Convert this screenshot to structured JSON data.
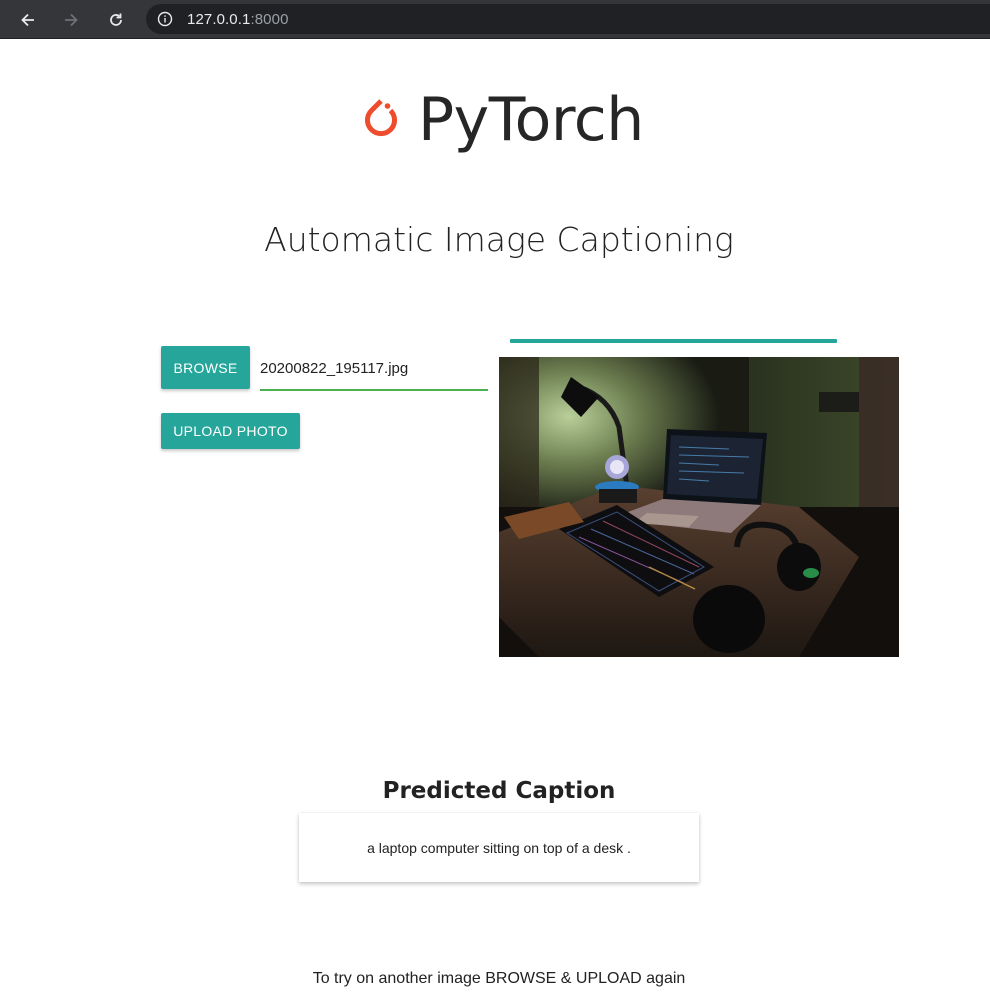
{
  "browser": {
    "url_host": "127.0.0.1",
    "url_port": ":8000",
    "back_icon": "back-arrow-icon",
    "forward_icon": "forward-arrow-icon",
    "reload_icon": "reload-icon",
    "info_icon": "info-icon"
  },
  "logo": {
    "text": "PyTorch",
    "icon": "pytorch-flame-icon",
    "color": "#ee4c2c"
  },
  "page": {
    "title": "Automatic Image Captioning"
  },
  "upload_form": {
    "browse_label": "BROWSE",
    "file_name": "20200822_195117.jpg",
    "upload_label": "UPLOAD PHOTO",
    "progress": 1.0
  },
  "image": {
    "alt": "uploaded photo of a desk with laptop, keyboard, lamp and headphones"
  },
  "result": {
    "heading": "Predicted Caption",
    "caption": "a laptop computer sitting on top of a desk ."
  },
  "footer": {
    "text": "To try on another image BROWSE & UPLOAD again"
  },
  "colors": {
    "accent": "#26a69a",
    "input_underline": "#4caf50"
  }
}
